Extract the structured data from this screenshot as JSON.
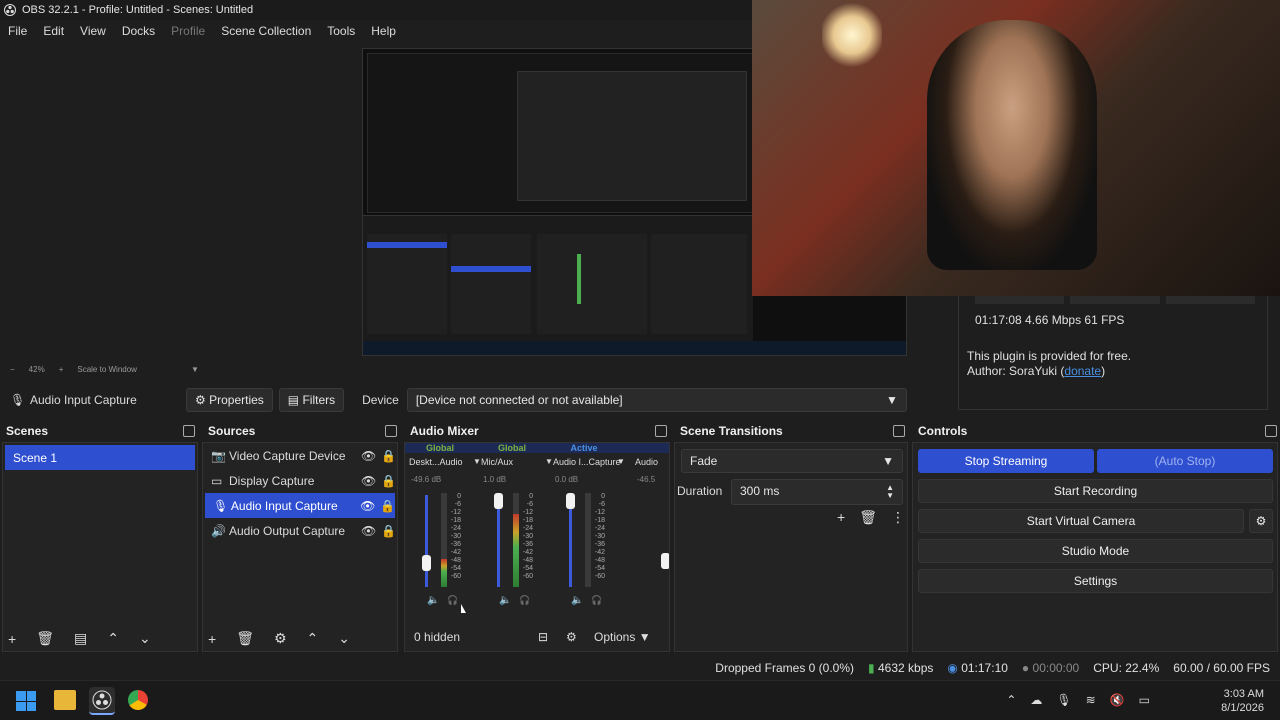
{
  "window": {
    "title": "OBS 32.2.1 - Profile: Untitled - Scenes: Untitled"
  },
  "menu": [
    "File",
    "Edit",
    "View",
    "Docks",
    "Profile",
    "Scene Collection",
    "Tools",
    "Help"
  ],
  "zoom": {
    "minus": "−",
    "level": "42%",
    "plus": "+",
    "mode": "Scale to Window"
  },
  "stream_stats": {
    "line1": "01:17:08  4.66 Mbps  61 FPS",
    "plugin_note": "This plugin is provided for free.",
    "author_prefix": "Author: SoraYuki (",
    "author_link": "donate",
    "author_suffix": ")"
  },
  "source_toolbar": {
    "selected_source": "Audio Input Capture",
    "properties_label": "Properties",
    "filters_label": "Filters",
    "device_label": "Device",
    "device_value": "[Device not connected or not available]"
  },
  "scenes": {
    "title": "Scenes",
    "items": [
      "Scene 1"
    ]
  },
  "sources": {
    "title": "Sources",
    "items": [
      {
        "label": "Video Capture Device",
        "icon": "camera-icon"
      },
      {
        "label": "Display Capture",
        "icon": "monitor-icon"
      },
      {
        "label": "Audio Input Capture",
        "icon": "microphone-icon"
      },
      {
        "label": "Audio Output Capture",
        "icon": "speaker-icon"
      }
    ]
  },
  "audio_mixer": {
    "title": "Audio Mixer",
    "channels": [
      {
        "tag": "Global",
        "name": "Deskt...Audio",
        "db": "-49.6 dB",
        "level": 0.3
      },
      {
        "tag": "Global",
        "name": "Mic/Aux",
        "db": "1.0 dB",
        "level": 0.78
      },
      {
        "tag": "Active",
        "name": "Audio I...Capture",
        "db": "0.0 dB",
        "level": 0.0
      },
      {
        "tag": "",
        "name": "Audio",
        "db": "-46.5",
        "level": 0.0
      }
    ],
    "ticks": [
      "0",
      "-6",
      "-12",
      "-18",
      "-24",
      "-30",
      "-36",
      "-42",
      "-48",
      "-54",
      "-60"
    ],
    "hidden_label": "0 hidden",
    "options_label": "Options"
  },
  "scene_transitions": {
    "title": "Scene Transitions",
    "transition": "Fade",
    "duration_label": "Duration",
    "duration_value": "300 ms"
  },
  "controls": {
    "title": "Controls",
    "stop_streaming": "Stop Streaming",
    "auto_stop": "(Auto Stop)",
    "start_recording": "Start Recording",
    "start_virtual_camera": "Start Virtual Camera",
    "studio_mode": "Studio Mode",
    "settings": "Settings"
  },
  "status": {
    "dropped": "Dropped Frames 0 (0.0%)",
    "bitrate": "4632 kbps",
    "stream_time": "01:17:10",
    "rec_time": "00:00:00",
    "cpu": "CPU: 22.4%",
    "fps": "60.00 / 60.00 FPS"
  },
  "taskbar": {
    "time": "3:03 AM",
    "date": "8/1/2026"
  },
  "colors": {
    "accent": "#2f4fd1",
    "bg": "#1e1e1e",
    "panel": "#232323",
    "link": "#4a90e2"
  }
}
